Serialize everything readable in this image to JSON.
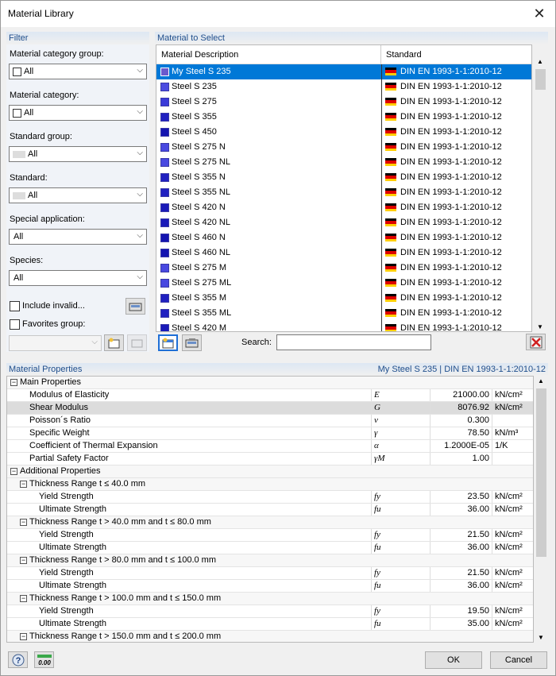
{
  "window": {
    "title": "Material Library",
    "close_glyph": "✕"
  },
  "filter": {
    "header": "Filter",
    "fields": [
      {
        "label": "Material category group:",
        "value": "All",
        "marker": "checkbox"
      },
      {
        "label": "Material category:",
        "value": "All",
        "marker": "checkbox"
      },
      {
        "label": "Standard group:",
        "value": "All",
        "marker": "swatch"
      },
      {
        "label": "Standard:",
        "value": "All",
        "marker": "swatch"
      },
      {
        "label": "Special application:",
        "value": "All",
        "marker": "none"
      },
      {
        "label": "Species:",
        "value": "All",
        "marker": "none"
      }
    ],
    "include_invalid_label": "Include invalid...",
    "favorites_label": "Favorites group:",
    "favorites_value": ""
  },
  "materials": {
    "header": "Material to Select",
    "col_description": "Material Description",
    "col_standard": "Standard",
    "rows": [
      {
        "desc": "My Steel S 235",
        "std": "DIN EN 1993-1-1:2010-12",
        "color": "#6a5acd",
        "selected": true
      },
      {
        "desc": "Steel S 235",
        "std": "DIN EN 1993-1-1:2010-12",
        "color": "#4b4be0"
      },
      {
        "desc": "Steel S 275",
        "std": "DIN EN 1993-1-1:2010-12",
        "color": "#3a3ad8"
      },
      {
        "desc": "Steel S 355",
        "std": "DIN EN 1993-1-1:2010-12",
        "color": "#2020c0"
      },
      {
        "desc": "Steel S 450",
        "std": "DIN EN 1993-1-1:2010-12",
        "color": "#1414b0"
      },
      {
        "desc": "Steel S 275 N",
        "std": "DIN EN 1993-1-1:2010-12",
        "color": "#4848e0"
      },
      {
        "desc": "Steel S 275 NL",
        "std": "DIN EN 1993-1-1:2010-12",
        "color": "#4848e0"
      },
      {
        "desc": "Steel S 355 N",
        "std": "DIN EN 1993-1-1:2010-12",
        "color": "#2020c0"
      },
      {
        "desc": "Steel S 355 NL",
        "std": "DIN EN 1993-1-1:2010-12",
        "color": "#2020c0"
      },
      {
        "desc": "Steel S 420 N",
        "std": "DIN EN 1993-1-1:2010-12",
        "color": "#1a1ab8"
      },
      {
        "desc": "Steel S 420 NL",
        "std": "DIN EN 1993-1-1:2010-12",
        "color": "#1a1ab8"
      },
      {
        "desc": "Steel S 460 N",
        "std": "DIN EN 1993-1-1:2010-12",
        "color": "#1414b0"
      },
      {
        "desc": "Steel S 460 NL",
        "std": "DIN EN 1993-1-1:2010-12",
        "color": "#1414b0"
      },
      {
        "desc": "Steel S 275 M",
        "std": "DIN EN 1993-1-1:2010-12",
        "color": "#4848e0"
      },
      {
        "desc": "Steel S 275 ML",
        "std": "DIN EN 1993-1-1:2010-12",
        "color": "#4848e0"
      },
      {
        "desc": "Steel S 355 M",
        "std": "DIN EN 1993-1-1:2010-12",
        "color": "#2020c0"
      },
      {
        "desc": "Steel S 355 ML",
        "std": "DIN EN 1993-1-1:2010-12",
        "color": "#2020c0"
      },
      {
        "desc": "Steel S 420 M",
        "std": "DIN EN 1993-1-1:2010-12",
        "color": "#1a1ab8"
      }
    ],
    "search_label": "Search:",
    "search_value": ""
  },
  "properties": {
    "header": "Material Properties",
    "selected_info": "My Steel S 235  |  DIN EN 1993-1-1:2010-12",
    "rows": [
      {
        "label": "Main Properties",
        "level": 0,
        "group": true,
        "expanded": true
      },
      {
        "label": "Modulus of Elasticity",
        "level": 1,
        "sym": "E",
        "value": "21000.00",
        "unit": "kN/cm²"
      },
      {
        "label": "Shear Modulus",
        "level": 1,
        "sym": "G",
        "value": "8076.92",
        "unit": "kN/cm²",
        "shaded": true
      },
      {
        "label": "Poisson´s Ratio",
        "level": 1,
        "sym": "ν",
        "value": "0.300",
        "unit": ""
      },
      {
        "label": "Specific Weight",
        "level": 1,
        "sym": "γ",
        "value": "78.50",
        "unit": "kN/m³"
      },
      {
        "label": "Coefficient of Thermal Expansion",
        "level": 1,
        "sym": "α",
        "value": "1.2000E-05",
        "unit": "1/K"
      },
      {
        "label": "Partial Safety Factor",
        "level": 1,
        "sym": "γM",
        "value": "1.00",
        "unit": ""
      },
      {
        "label": "Additional Properties",
        "level": 0,
        "group": true,
        "expanded": true
      },
      {
        "label": "Thickness Range t ≤ 40.0 mm",
        "level": 1,
        "group": true,
        "expanded": true
      },
      {
        "label": "Yield Strength",
        "level": 2,
        "sym": "fy",
        "value": "23.50",
        "unit": "kN/cm²"
      },
      {
        "label": "Ultimate Strength",
        "level": 2,
        "sym": "fu",
        "value": "36.00",
        "unit": "kN/cm²"
      },
      {
        "label": "Thickness Range t > 40.0 mm and t ≤ 80.0 mm",
        "level": 1,
        "group": true,
        "expanded": true
      },
      {
        "label": "Yield Strength",
        "level": 2,
        "sym": "fy",
        "value": "21.50",
        "unit": "kN/cm²"
      },
      {
        "label": "Ultimate Strength",
        "level": 2,
        "sym": "fu",
        "value": "36.00",
        "unit": "kN/cm²"
      },
      {
        "label": "Thickness Range t > 80.0 mm and t ≤ 100.0 mm",
        "level": 1,
        "group": true,
        "expanded": true
      },
      {
        "label": "Yield Strength",
        "level": 2,
        "sym": "fy",
        "value": "21.50",
        "unit": "kN/cm²"
      },
      {
        "label": "Ultimate Strength",
        "level": 2,
        "sym": "fu",
        "value": "36.00",
        "unit": "kN/cm²"
      },
      {
        "label": "Thickness Range t > 100.0 mm and t ≤ 150.0 mm",
        "level": 1,
        "group": true,
        "expanded": true
      },
      {
        "label": "Yield Strength",
        "level": 2,
        "sym": "fy",
        "value": "19.50",
        "unit": "kN/cm²"
      },
      {
        "label": "Ultimate Strength",
        "level": 2,
        "sym": "fu",
        "value": "35.00",
        "unit": "kN/cm²"
      },
      {
        "label": "Thickness Range t > 150.0 mm and t ≤ 200.0 mm",
        "level": 1,
        "group": true,
        "expanded": true
      }
    ]
  },
  "footer": {
    "ok": "OK",
    "cancel": "Cancel",
    "units_icon_text": "0.00"
  }
}
